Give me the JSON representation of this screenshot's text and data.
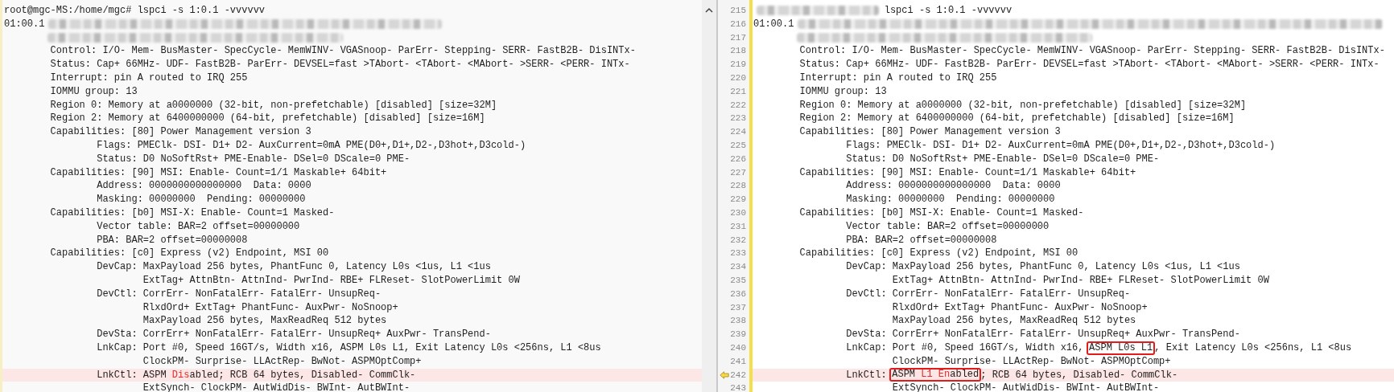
{
  "left": {
    "lines": [
      {
        "changed": false,
        "text": "root@mgc-MS:/home/mgc# lspci -s 1:0.1 -vvvvvv"
      },
      {
        "changed": false,
        "parts": [
          {
            "kind": "text",
            "text": "01:00.1",
            "changed": false
          },
          {
            "kind": "redacted"
          }
        ]
      },
      {
        "changed": false,
        "parts": [
          {
            "kind": "redacted"
          }
        ]
      },
      {
        "changed": false,
        "text": "        Control: I/O- Mem- BusMaster- SpecCycle- MemWINV- VGASnoop- ParErr- Stepping- SERR- FastB2B- DisINTx-"
      },
      {
        "changed": false,
        "text": "        Status: Cap+ 66MHz- UDF- FastB2B- ParErr- DEVSEL=fast >TAbort- <TAbort- <MAbort- >SERR- <PERR- INTx-"
      },
      {
        "changed": false,
        "text": "        Interrupt: pin A routed to IRQ 255"
      },
      {
        "changed": false,
        "text": "        IOMMU group: 13"
      },
      {
        "changed": false,
        "text": "        Region 0: Memory at a0000000 (32-bit, non-prefetchable) [disabled] [size=32M]"
      },
      {
        "changed": false,
        "text": "        Region 2: Memory at 6400000000 (64-bit, prefetchable) [disabled] [size=16M]"
      },
      {
        "changed": false,
        "text": "        Capabilities: [80] Power Management version 3"
      },
      {
        "changed": false,
        "text": "                Flags: PMEClk- DSI- D1+ D2- AuxCurrent=0mA PME(D0+,D1+,D2-,D3hot+,D3cold-)"
      },
      {
        "changed": false,
        "text": "                Status: D0 NoSoftRst+ PME-Enable- DSel=0 DScale=0 PME-"
      },
      {
        "changed": false,
        "text": "        Capabilities: [90] MSI: Enable- Count=1/1 Maskable+ 64bit+"
      },
      {
        "changed": false,
        "text": "                Address: 0000000000000000  Data: 0000"
      },
      {
        "changed": false,
        "text": "                Masking: 00000000  Pending: 00000000"
      },
      {
        "changed": false,
        "text": "        Capabilities: [b0] MSI-X: Enable- Count=1 Masked-"
      },
      {
        "changed": false,
        "text": "                Vector table: BAR=2 offset=00000000"
      },
      {
        "changed": false,
        "text": "                PBA: BAR=2 offset=00000008"
      },
      {
        "changed": false,
        "text": "        Capabilities: [c0] Express (v2) Endpoint, MSI 00"
      },
      {
        "changed": false,
        "text": "                DevCap: MaxPayload 256 bytes, PhantFunc 0, Latency L0s <1us, L1 <1us"
      },
      {
        "changed": false,
        "text": "                        ExtTag+ AttnBtn- AttnInd- PwrInd- RBE+ FLReset- SlotPowerLimit 0W"
      },
      {
        "changed": false,
        "text": "                DevCtl: CorrErr- NonFatalErr- FatalErr- UnsupReq-"
      },
      {
        "changed": false,
        "text": "                        RlxdOrd+ ExtTag+ PhantFunc- AuxPwr- NoSnoop+"
      },
      {
        "changed": false,
        "text": "                        MaxPayload 256 bytes, MaxReadReq 512 bytes"
      },
      {
        "changed": false,
        "text": "                DevSta: CorrErr+ NonFatalErr- FatalErr- UnsupReq+ AuxPwr- TransPend-"
      },
      {
        "changed": false,
        "text": "                LnkCap: Port #0, Speed 16GT/s, Width x16, ASPM L0s L1, Exit Latency L0s <256ns, L1 <8us"
      },
      {
        "changed": false,
        "text": "                        ClockPM- Surprise- LLActRep- BwNot- ASPMOptComp+"
      },
      {
        "changed": true,
        "parts": [
          {
            "kind": "text",
            "text": "                LnkCtl: ASPM",
            "changed": false
          },
          {
            "kind": "text",
            "text": " Dis",
            "changed": true
          },
          {
            "kind": "text",
            "text": "abled; RCB 64 bytes, Disabled- CommClk-",
            "changed": false
          }
        ]
      },
      {
        "changed": false,
        "text": "                        ExtSynch- ClockPM- AutWidDis- BWInt- AutBWInt-"
      }
    ]
  },
  "right": {
    "lines": [
      {
        "number": "215",
        "arrow": false,
        "changed": false,
        "parts": [
          {
            "kind": "redacted"
          },
          {
            "kind": "text",
            "text": " lspci -s 1:0.1 -vvvvvv",
            "changed": false
          }
        ]
      },
      {
        "number": "216",
        "arrow": false,
        "changed": false,
        "parts": [
          {
            "kind": "text",
            "text": "01:00.1",
            "changed": false
          },
          {
            "kind": "redacted"
          }
        ]
      },
      {
        "number": "217",
        "arrow": false,
        "changed": false,
        "parts": [
          {
            "kind": "redacted"
          }
        ]
      },
      {
        "number": "218",
        "arrow": false,
        "changed": false,
        "text": "        Control: I/O- Mem- BusMaster- SpecCycle- MemWINV- VGASnoop- ParErr- Stepping- SERR- FastB2B- DisINTx-"
      },
      {
        "number": "219",
        "arrow": false,
        "changed": false,
        "text": "        Status: Cap+ 66MHz- UDF- FastB2B- ParErr- DEVSEL=fast >TAbort- <TAbort- <MAbort- >SERR- <PERR- INTx-"
      },
      {
        "number": "220",
        "arrow": false,
        "changed": false,
        "text": "        Interrupt: pin A routed to IRQ 255"
      },
      {
        "number": "221",
        "arrow": false,
        "changed": false,
        "text": "        IOMMU group: 13"
      },
      {
        "number": "222",
        "arrow": false,
        "changed": false,
        "text": "        Region 0: Memory at a0000000 (32-bit, non-prefetchable) [disabled] [size=32M]"
      },
      {
        "number": "223",
        "arrow": false,
        "changed": false,
        "text": "        Region 2: Memory at 6400000000 (64-bit, prefetchable) [disabled] [size=16M]"
      },
      {
        "number": "224",
        "arrow": false,
        "changed": false,
        "text": "        Capabilities: [80] Power Management version 3"
      },
      {
        "number": "225",
        "arrow": false,
        "changed": false,
        "text": "                Flags: PMEClk- DSI- D1+ D2- AuxCurrent=0mA PME(D0+,D1+,D2-,D3hot+,D3cold-)"
      },
      {
        "number": "226",
        "arrow": false,
        "changed": false,
        "text": "                Status: D0 NoSoftRst+ PME-Enable- DSel=0 DScale=0 PME-"
      },
      {
        "number": "227",
        "arrow": false,
        "changed": false,
        "text": "        Capabilities: [90] MSI: Enable- Count=1/1 Maskable+ 64bit+"
      },
      {
        "number": "228",
        "arrow": false,
        "changed": false,
        "text": "                Address: 0000000000000000  Data: 0000"
      },
      {
        "number": "229",
        "arrow": false,
        "changed": false,
        "text": "                Masking: 00000000  Pending: 00000000"
      },
      {
        "number": "230",
        "arrow": false,
        "changed": false,
        "text": "        Capabilities: [b0] MSI-X: Enable- Count=1 Masked-"
      },
      {
        "number": "231",
        "arrow": false,
        "changed": false,
        "text": "                Vector table: BAR=2 offset=00000000"
      },
      {
        "number": "232",
        "arrow": false,
        "changed": false,
        "text": "                PBA: BAR=2 offset=00000008"
      },
      {
        "number": "233",
        "arrow": false,
        "changed": false,
        "text": "        Capabilities: [c0] Express (v2) Endpoint, MSI 00"
      },
      {
        "number": "234",
        "arrow": false,
        "changed": false,
        "text": "                DevCap: MaxPayload 256 bytes, PhantFunc 0, Latency L0s <1us, L1 <1us"
      },
      {
        "number": "235",
        "arrow": false,
        "changed": false,
        "text": "                        ExtTag+ AttnBtn- AttnInd- PwrInd- RBE+ FLReset- SlotPowerLimit 0W"
      },
      {
        "number": "236",
        "arrow": false,
        "changed": false,
        "text": "                DevCtl: CorrErr- NonFatalErr- FatalErr- UnsupReq-"
      },
      {
        "number": "237",
        "arrow": false,
        "changed": false,
        "text": "                        RlxdOrd+ ExtTag+ PhantFunc- AuxPwr- NoSnoop+"
      },
      {
        "number": "238",
        "arrow": false,
        "changed": false,
        "text": "                        MaxPayload 256 bytes, MaxReadReq 512 bytes"
      },
      {
        "number": "239",
        "arrow": false,
        "changed": false,
        "text": "                DevSta: CorrErr+ NonFatalErr- FatalErr- UnsupReq+ AuxPwr- TransPend-"
      },
      {
        "number": "240",
        "arrow": false,
        "changed": false,
        "parts": [
          {
            "kind": "text",
            "text": "                LnkCap: Port #0, Speed 16GT/s, Width x16,",
            "changed": false
          },
          {
            "kind": "box",
            "parts": [
              {
                "text": "ASPM L0s L1",
                "changed": false
              }
            ]
          },
          {
            "kind": "text",
            "text": ", Exit Latency L0s <256ns, L1 <8us",
            "changed": false
          }
        ]
      },
      {
        "number": "241",
        "arrow": false,
        "changed": false,
        "text": "                        ClockPM- Surprise- LLActRep- BwNot- ASPMOptComp+"
      },
      {
        "number": "242",
        "arrow": true,
        "changed": true,
        "parts": [
          {
            "kind": "text",
            "text": "                LnkCtl:",
            "changed": false
          },
          {
            "kind": "box",
            "parts": [
              {
                "text": "ASPM ",
                "changed": false
              },
              {
                "text": "L1 En",
                "changed": true
              },
              {
                "text": "abled",
                "changed": false
              }
            ]
          },
          {
            "kind": "text",
            "text": "; RCB 64 bytes, Disabled- CommClk-",
            "changed": false
          }
        ]
      },
      {
        "number": "243",
        "arrow": false,
        "changed": false,
        "text": "                        ExtSynch- ClockPM- AutWidDis- BWInt- AutBWInt-"
      }
    ]
  }
}
